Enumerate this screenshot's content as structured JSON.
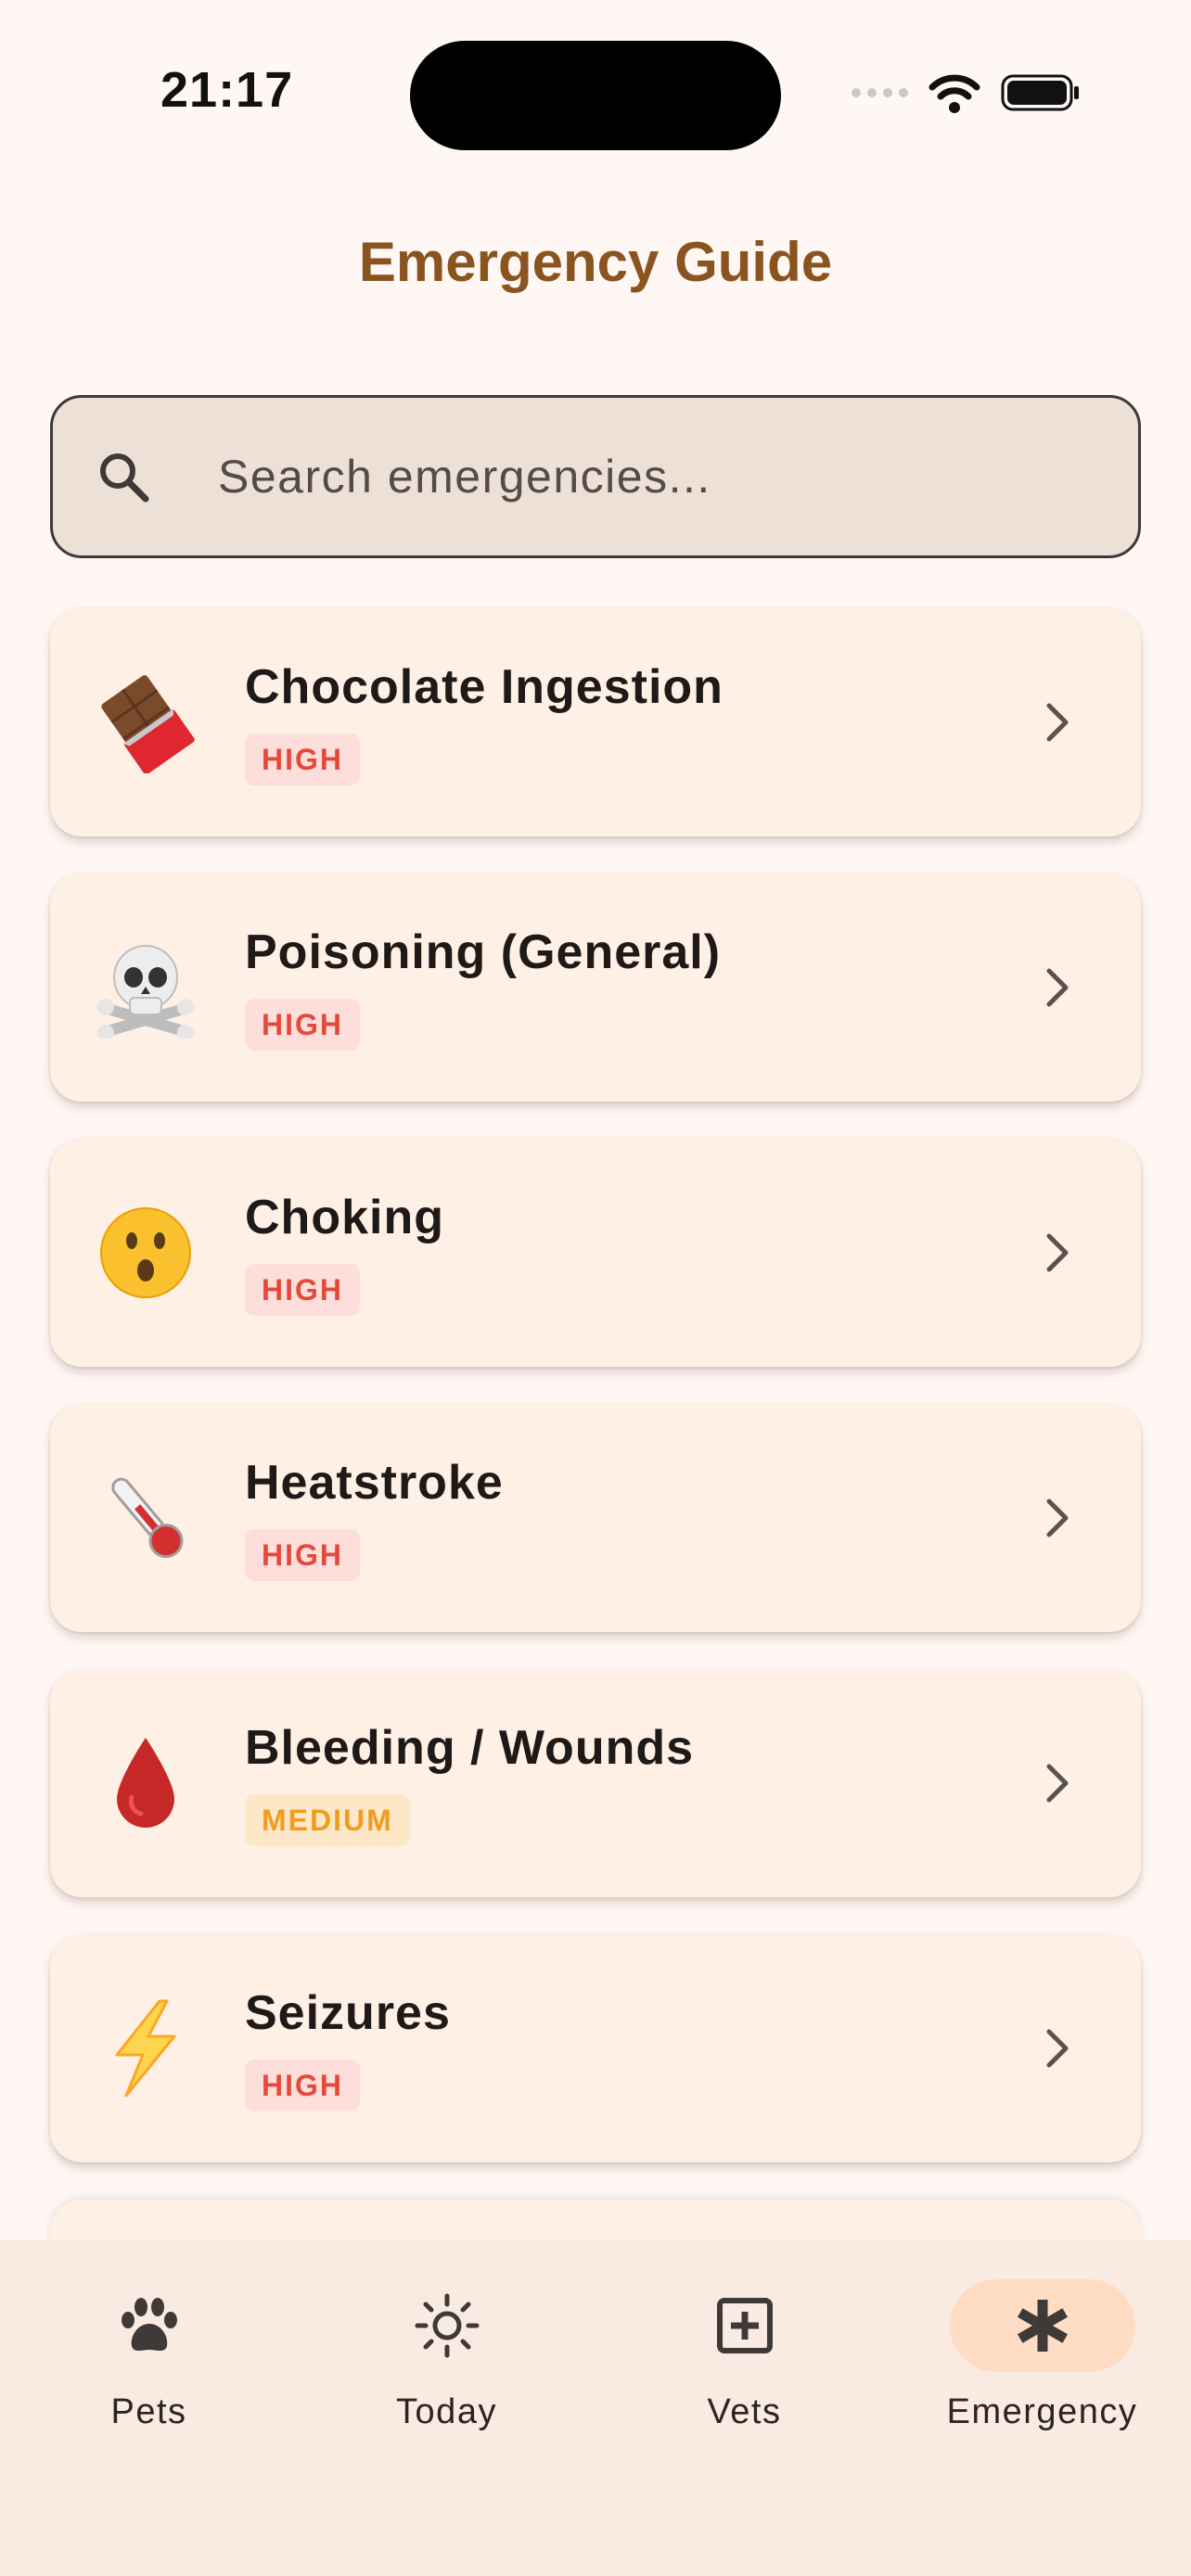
{
  "status_bar": {
    "time": "21:17"
  },
  "header": {
    "title": "Emergency Guide"
  },
  "search": {
    "placeholder": "Search emergencies..."
  },
  "emergencies": [
    {
      "title": "Chocolate Ingestion",
      "severity": "HIGH",
      "icon": "chocolate-bar-icon"
    },
    {
      "title": "Poisoning (General)",
      "severity": "HIGH",
      "icon": "skull-crossbones-icon"
    },
    {
      "title": "Choking",
      "severity": "HIGH",
      "icon": "surprised-face-icon"
    },
    {
      "title": "Heatstroke",
      "severity": "HIGH",
      "icon": "thermometer-icon"
    },
    {
      "title": "Bleeding / Wounds",
      "severity": "MEDIUM",
      "icon": "blood-drop-icon"
    },
    {
      "title": "Seizures",
      "severity": "HIGH",
      "icon": "lightning-bolt-icon"
    }
  ],
  "nav": {
    "items": [
      {
        "label": "Pets",
        "icon": "paw-icon"
      },
      {
        "label": "Today",
        "icon": "sun-icon"
      },
      {
        "label": "Vets",
        "icon": "medical-cross-icon"
      },
      {
        "label": "Emergency",
        "icon": "asterisk-icon",
        "active": true
      }
    ]
  },
  "colors": {
    "background": "#FFF7F3",
    "title": "#8A5420",
    "card": "#FFF0E6",
    "high_badge_text": "#E34A3C",
    "medium_badge_text": "#F29C1F",
    "nav_active": "#FFDCC4"
  }
}
